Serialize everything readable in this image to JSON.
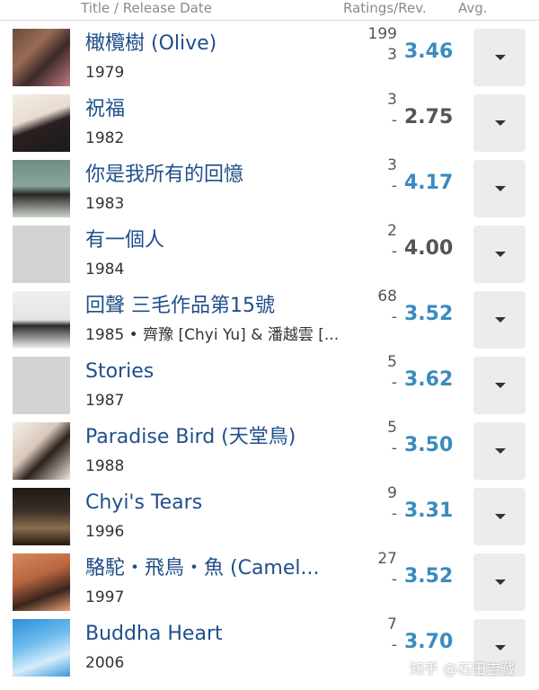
{
  "header": {
    "title_col": "Title  /  Release Date",
    "ratings_col": "Ratings/Rev.",
    "avg_col": "Avg."
  },
  "albums": [
    {
      "title": "橄欖樹 (Olive)",
      "meta": "1979",
      "ratings": "199",
      "reviews": "3",
      "avg": "3.46",
      "avg_color": "blue"
    },
    {
      "title": "祝福",
      "meta": "1982",
      "ratings": "3",
      "reviews": "-",
      "avg": "2.75",
      "avg_color": "gray"
    },
    {
      "title": "你是我所有的回憶",
      "meta": "1983",
      "ratings": "3",
      "reviews": "-",
      "avg": "4.17",
      "avg_color": "blue"
    },
    {
      "title": "有一個人",
      "meta": "1984",
      "ratings": "2",
      "reviews": "-",
      "avg": "4.00",
      "avg_color": "gray"
    },
    {
      "title": "回聲 三毛作品第15號",
      "meta": "1985 • 齊豫 [Chyi Yu] & 潘越雲 [...",
      "ratings": "68",
      "reviews": "-",
      "avg": "3.52",
      "avg_color": "blue"
    },
    {
      "title": "Stories",
      "meta": "1987",
      "ratings": "5",
      "reviews": "-",
      "avg": "3.62",
      "avg_color": "blue"
    },
    {
      "title": "Paradise Bird (天堂鳥)",
      "meta": "1988",
      "ratings": "5",
      "reviews": "-",
      "avg": "3.50",
      "avg_color": "blue"
    },
    {
      "title": "Chyi's Tears",
      "meta": "1996",
      "ratings": "9",
      "reviews": "-",
      "avg": "3.31",
      "avg_color": "blue"
    },
    {
      "title": "駱駝・飛鳥・魚 (Camel...",
      "meta": "1997",
      "ratings": "27",
      "reviews": "-",
      "avg": "3.52",
      "avg_color": "blue"
    },
    {
      "title": "Buddha Heart",
      "meta": "2006",
      "ratings": "7",
      "reviews": "-",
      "avg": "3.70",
      "avg_color": "blue"
    }
  ],
  "icons": {
    "dropdown": "caret-down-icon"
  },
  "colors": {
    "link": "#1f4f8a",
    "avg_blue": "#3a8bbf",
    "avg_gray": "#555555",
    "button_bg": "#ececec"
  },
  "watermark": "知乎 @石田吉藏"
}
